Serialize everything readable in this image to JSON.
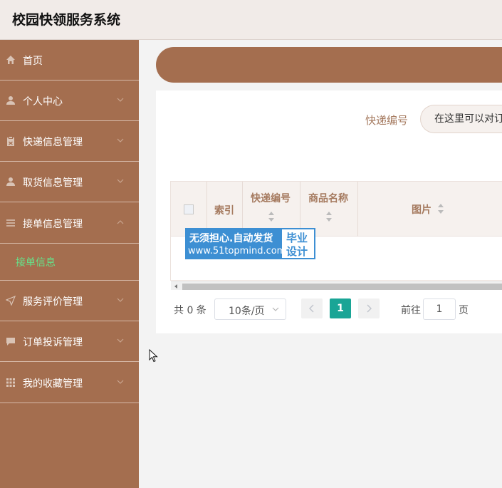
{
  "app": {
    "title": "校园快领服务系统"
  },
  "sidebar": {
    "items": [
      {
        "label": "首页",
        "icon": "home-icon"
      },
      {
        "label": "个人中心",
        "icon": "user-icon"
      },
      {
        "label": "快递信息管理",
        "icon": "clipboard-icon"
      },
      {
        "label": "取货信息管理",
        "icon": "user-icon"
      },
      {
        "label": "接单信息管理",
        "icon": "list-icon"
      },
      {
        "label": "服务评价管理",
        "icon": "send-icon"
      },
      {
        "label": "订单投诉管理",
        "icon": "message-icon"
      },
      {
        "label": "我的收藏管理",
        "icon": "grid-icon"
      }
    ],
    "submenu": {
      "label": "接单信息"
    }
  },
  "search": {
    "label": "快递编号",
    "placeholder": "在这里可以对订"
  },
  "table": {
    "columns": [
      "索引",
      "快递编号",
      "商品名称",
      "图片"
    ]
  },
  "pagination": {
    "total": "共 0 条",
    "page_size": "10条/页",
    "current_page": "1",
    "goto_label": "前往",
    "goto_value": "1",
    "page_suffix": "页"
  },
  "watermark": {
    "line1": "无须担心.自动发货",
    "line2": "www.51topmind.com",
    "badge_line1": "毕业",
    "badge_line2": "设计"
  },
  "colors": {
    "sidebar": "#a46e4f",
    "accent": "#1aa596",
    "active_submenu": "#66e28a",
    "label": "#a57a5f"
  }
}
